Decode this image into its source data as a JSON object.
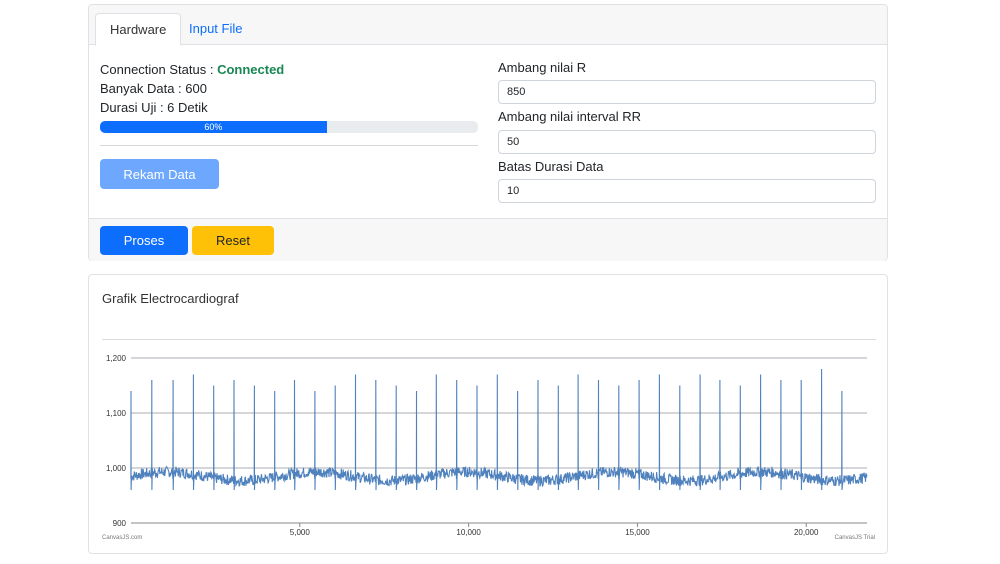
{
  "tabs": {
    "hardware": "Hardware",
    "input_file": "Input File"
  },
  "status": {
    "connection_label": "Connection Status : ",
    "connection_value": "Connected",
    "banyak_data": "Banyak Data : 600",
    "durasi_uji": "Durasi Uji : 6 Detik",
    "progress_text": "60%",
    "progress_value": 0.6
  },
  "buttons": {
    "rekam": "Rekam Data",
    "proses": "Proses",
    "reset": "Reset"
  },
  "form": {
    "ambang_r_label": "Ambang nilai R",
    "ambang_r_value": "850",
    "ambang_rr_label": "Ambang nilai interval RR",
    "ambang_rr_value": "50",
    "batas_durasi_label": "Batas Durasi Data",
    "batas_durasi_value": "10"
  },
  "colors": {
    "primary": "#0d6efd",
    "primary_disabled": "#6ea8fe",
    "warning": "#ffc107",
    "success": "#198754",
    "ecg_line": "#4f81bd"
  },
  "chart_data": {
    "type": "line",
    "title": "Grafik Electrocardiograf",
    "xlabel": "",
    "ylabel": "",
    "xlim": [
      0,
      21800
    ],
    "ylim": [
      900,
      1200
    ],
    "x_ticks": [
      5000,
      10000,
      15000,
      20000
    ],
    "x_tick_labels": [
      "5,000",
      "10,000",
      "15,000",
      "20,000"
    ],
    "y_ticks": [
      900,
      1000,
      1100,
      1200
    ],
    "y_tick_labels": [
      "900",
      "1,000",
      "1,100",
      "1,200"
    ],
    "credit_left": "CanvasJS.com",
    "credit_right": "CanvasJS Trial",
    "series": [
      {
        "baseline": 985,
        "noise": 10,
        "r_peaks": [
          {
            "x": 0,
            "y": 1140
          },
          {
            "x": 620,
            "y": 1160
          },
          {
            "x": 1250,
            "y": 1160
          },
          {
            "x": 1850,
            "y": 1170
          },
          {
            "x": 2450,
            "y": 1150
          },
          {
            "x": 3050,
            "y": 1160
          },
          {
            "x": 3650,
            "y": 1150
          },
          {
            "x": 4250,
            "y": 1140
          },
          {
            "x": 4850,
            "y": 1160
          },
          {
            "x": 5450,
            "y": 1140
          },
          {
            "x": 6050,
            "y": 1150
          },
          {
            "x": 6650,
            "y": 1170
          },
          {
            "x": 7250,
            "y": 1160
          },
          {
            "x": 7850,
            "y": 1150
          },
          {
            "x": 8450,
            "y": 1140
          },
          {
            "x": 9050,
            "y": 1170
          },
          {
            "x": 9650,
            "y": 1160
          },
          {
            "x": 10250,
            "y": 1150
          },
          {
            "x": 10850,
            "y": 1170
          },
          {
            "x": 11450,
            "y": 1140
          },
          {
            "x": 12050,
            "y": 1160
          },
          {
            "x": 12650,
            "y": 1150
          },
          {
            "x": 13250,
            "y": 1170
          },
          {
            "x": 13850,
            "y": 1160
          },
          {
            "x": 14450,
            "y": 1150
          },
          {
            "x": 15050,
            "y": 1160
          },
          {
            "x": 15650,
            "y": 1170
          },
          {
            "x": 16250,
            "y": 1150
          },
          {
            "x": 16850,
            "y": 1170
          },
          {
            "x": 17450,
            "y": 1160
          },
          {
            "x": 18050,
            "y": 1150
          },
          {
            "x": 18650,
            "y": 1170
          },
          {
            "x": 19250,
            "y": 1160
          },
          {
            "x": 19850,
            "y": 1160
          },
          {
            "x": 20450,
            "y": 1180
          },
          {
            "x": 21050,
            "y": 1140
          }
        ]
      }
    ]
  }
}
